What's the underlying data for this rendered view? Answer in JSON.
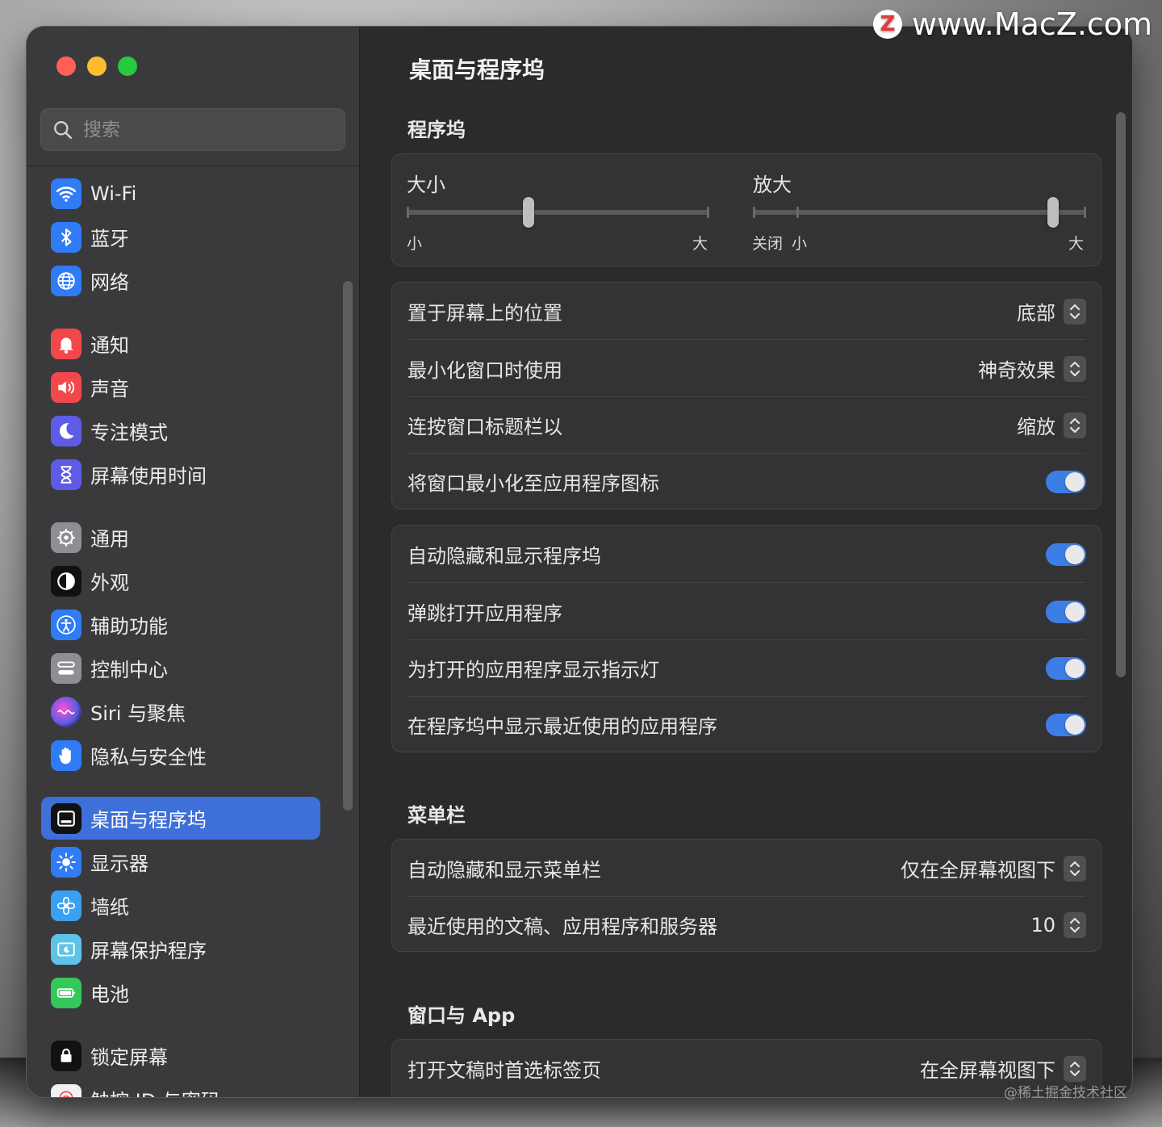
{
  "watermark": {
    "logo": "Z",
    "text": "www.MacZ.com"
  },
  "credit": "@稀土掘金技术社区",
  "search": {
    "placeholder": "搜索"
  },
  "sidebar": {
    "items": [
      {
        "label": "Wi-Fi",
        "icon": "wifi-icon",
        "color": "#2f7cf6"
      },
      {
        "label": "蓝牙",
        "icon": "bluetooth-icon",
        "color": "#2f7cf6"
      },
      {
        "label": "网络",
        "icon": "globe-icon",
        "color": "#2f7cf6"
      },
      {
        "label": "通知",
        "icon": "bell-icon",
        "color": "#f2484b"
      },
      {
        "label": "声音",
        "icon": "speaker-icon",
        "color": "#f2484b"
      },
      {
        "label": "专注模式",
        "icon": "moon-icon",
        "color": "#5e5ce6"
      },
      {
        "label": "屏幕使用时间",
        "icon": "hourglass-icon",
        "color": "#5e5ce6"
      },
      {
        "label": "通用",
        "icon": "gear-icon",
        "color": "#8e8e93"
      },
      {
        "label": "外观",
        "icon": "appearance-icon",
        "color": "#111111"
      },
      {
        "label": "辅助功能",
        "icon": "accessibility-icon",
        "color": "#2f7cf6"
      },
      {
        "label": "控制中心",
        "icon": "control-center-icon",
        "color": "#8e8e93"
      },
      {
        "label": "Siri 与聚焦",
        "icon": "siri-icon",
        "color": "#8a3fd1"
      },
      {
        "label": "隐私与安全性",
        "icon": "hand-icon",
        "color": "#2f7cf6"
      },
      {
        "label": "桌面与程序坞",
        "icon": "dock-icon",
        "color": "#111111"
      },
      {
        "label": "显示器",
        "icon": "sun-icon",
        "color": "#2f7cf6"
      },
      {
        "label": "墙纸",
        "icon": "flower-icon",
        "color": "#3aa0f0"
      },
      {
        "label": "屏幕保护程序",
        "icon": "screensaver-icon",
        "color": "#5ec3e8"
      },
      {
        "label": "电池",
        "icon": "battery-icon",
        "color": "#34c759"
      },
      {
        "label": "锁定屏幕",
        "icon": "lock-icon",
        "color": "#111111"
      },
      {
        "label": "触控 ID 与密码",
        "icon": "fingerprint-icon",
        "color": "#f2f2f2"
      }
    ],
    "selected": "桌面与程序坞"
  },
  "main": {
    "title": "桌面与程序坞",
    "dock_section": "程序坞",
    "size_slider": {
      "label": "大小",
      "min_label": "小",
      "max_label": "大",
      "value": 0.4
    },
    "magnify_slider": {
      "label": "放大",
      "off_label": "关闭",
      "min_label": "小",
      "max_label": "大",
      "value": 0.9
    },
    "group1": [
      {
        "label": "置于屏幕上的位置",
        "value": "底部"
      },
      {
        "label": "最小化窗口时使用",
        "value": "神奇效果"
      },
      {
        "label": "连按窗口标题栏以",
        "value": "缩放"
      },
      {
        "label": "将窗口最小化至应用程序图标",
        "toggle": true
      }
    ],
    "group2": [
      {
        "label": "自动隐藏和显示程序坞",
        "toggle": true
      },
      {
        "label": "弹跳打开应用程序",
        "toggle": true
      },
      {
        "label": "为打开的应用程序显示指示灯",
        "toggle": true
      },
      {
        "label": "在程序坞中显示最近使用的应用程序",
        "toggle": true
      }
    ],
    "menubar_section": "菜单栏",
    "group3": [
      {
        "label": "自动隐藏和显示菜单栏",
        "value": "仅在全屏幕视图下"
      },
      {
        "label": "最近使用的文稿、应用程序和服务器",
        "value": "10"
      }
    ],
    "windows_section": "窗口与 App",
    "group4": [
      {
        "label": "打开文稿时首选标签页",
        "value": "在全屏幕视图下"
      }
    ]
  },
  "colors": {
    "accent": "#3f6fd8",
    "toggle_on": "#3d7ee6"
  }
}
